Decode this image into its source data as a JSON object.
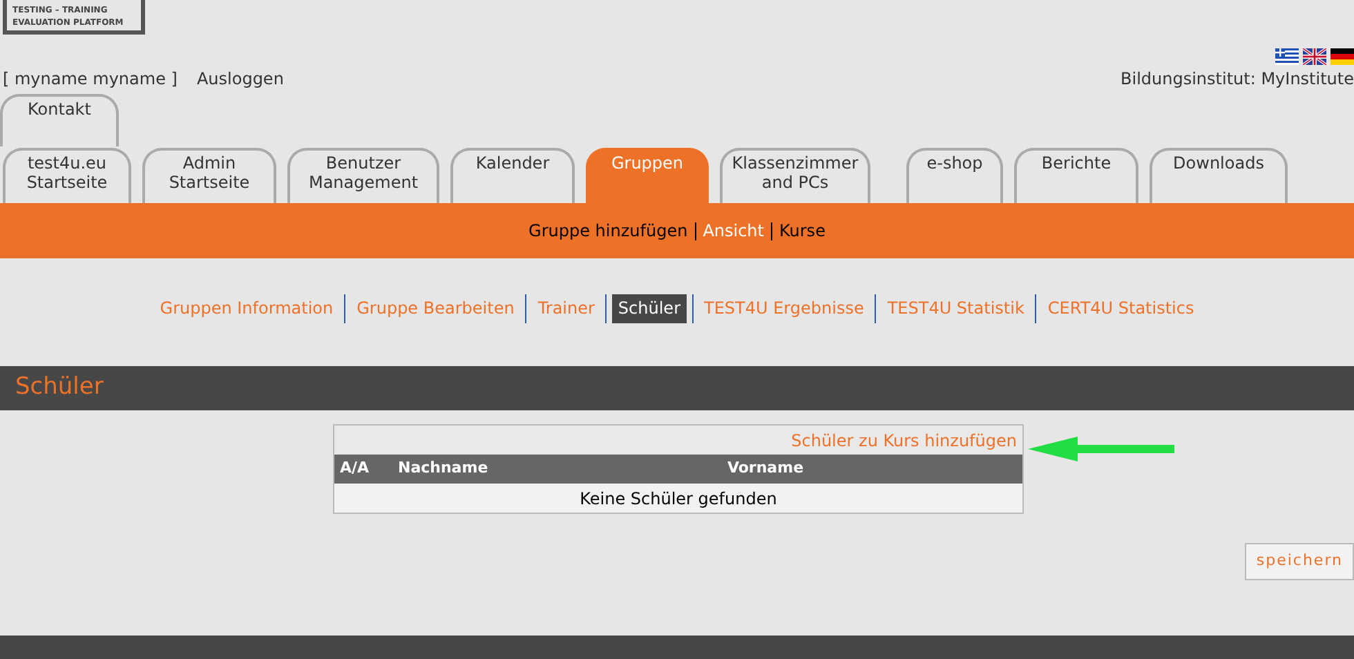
{
  "logo": {
    "lines": [
      "TESTING – TRAINING",
      "EVALUATION PLATFORM"
    ]
  },
  "user": {
    "name": "[ myname myname ]",
    "logout": "Ausloggen"
  },
  "institute": "Bildungsinstitut: MyInstitute",
  "top_tabs": [
    {
      "label": "Kontakt",
      "selected": false
    }
  ],
  "tabs": [
    {
      "label": "test4u.eu\nStartseite",
      "selected": false
    },
    {
      "label": "Admin\nStartseite",
      "selected": false
    },
    {
      "label": "Benutzer\nManagement",
      "selected": false
    },
    {
      "label": "Kalender",
      "selected": false
    },
    {
      "label": "Gruppen",
      "selected": true
    },
    {
      "label": "Klassenzimmer\nand PCs",
      "selected": false
    },
    {
      "label": "e-shop",
      "selected": false
    },
    {
      "label": "Berichte",
      "selected": false
    },
    {
      "label": "Downloads",
      "selected": false
    }
  ],
  "subnav": [
    {
      "label": "Gruppe hinzufügen",
      "selected": false
    },
    {
      "label": "Ansicht",
      "selected": true
    },
    {
      "label": "Kurse",
      "selected": false
    }
  ],
  "group_tabs": [
    {
      "label": "Gruppen Information",
      "selected": false
    },
    {
      "label": "Gruppe Bearbeiten",
      "selected": false
    },
    {
      "label": "Trainer",
      "selected": false
    },
    {
      "label": "Schüler",
      "selected": true
    },
    {
      "label": "TEST4U Ergebnisse",
      "selected": false
    },
    {
      "label": "TEST4U Statistik",
      "selected": false
    },
    {
      "label": "CERT4U Statistics",
      "selected": false
    }
  ],
  "section_title": "Schüler",
  "table": {
    "action": "Schüler zu Kurs hinzufügen",
    "columns": [
      "A/A",
      "Nachname",
      "Vorname"
    ],
    "empty": "Keine Schüler gefunden"
  },
  "save_button": "speichern"
}
